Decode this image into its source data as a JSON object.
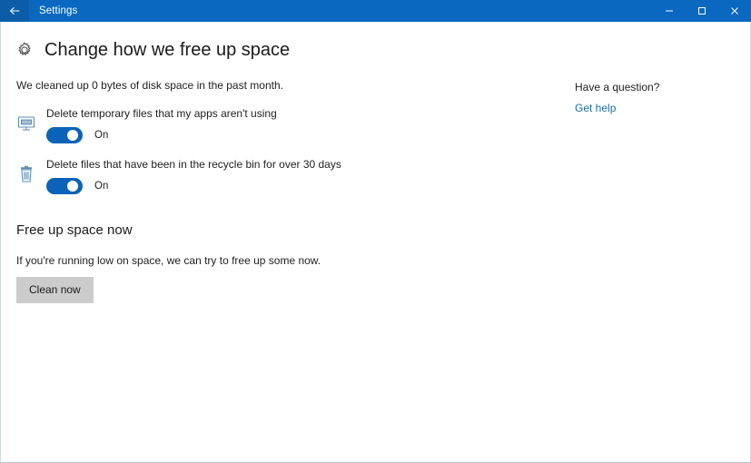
{
  "titlebar": {
    "back_icon": "back-arrow-icon",
    "app_title": "Settings",
    "minimize_icon": "minimize-icon",
    "maximize_icon": "maximize-icon",
    "close_icon": "close-icon",
    "bar_color": "#0a68c0",
    "back_button_color": "#0b5da8"
  },
  "page": {
    "icon": "gear-icon",
    "title": "Change how we free up space",
    "summary": "We cleaned up 0 bytes of disk space in the past month."
  },
  "settings": [
    {
      "icon": "monitor-temp-files-icon",
      "label": "Delete temporary files that my apps aren't using",
      "toggle_state": "On",
      "toggle_color": "#0a63b8"
    },
    {
      "icon": "recycle-bin-icon",
      "label": "Delete files that have been in the recycle bin for over 30 days",
      "toggle_state": "On",
      "toggle_color": "#0a63b8"
    }
  ],
  "free_up_section": {
    "heading": "Free up space now",
    "description": "If you're running low on space, we can try to free up some now.",
    "button_label": "Clean now"
  },
  "side": {
    "heading": "Have a question?",
    "link_label": "Get help",
    "link_color": "#1a6fa8"
  }
}
